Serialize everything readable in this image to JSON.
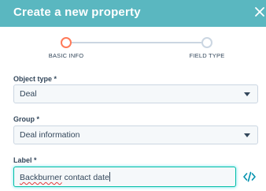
{
  "header": {
    "title": "Create a new property",
    "close_icon": "close-icon",
    "background": "#5ab7c0"
  },
  "stepper": {
    "steps": [
      {
        "label": "BASIC INFO",
        "state": "active"
      },
      {
        "label": "FIELD TYPE",
        "state": "inactive"
      }
    ],
    "active_color": "#ff7a59"
  },
  "form": {
    "object_type": {
      "label": "Object type *",
      "value": "Deal"
    },
    "group": {
      "label": "Group *",
      "value": "Deal information"
    },
    "label_field": {
      "label": "Label *",
      "value": "Backburner contact date",
      "value_misspelled": "Backburner",
      "value_rest": " contact date"
    },
    "code_icon": "code-icon"
  }
}
